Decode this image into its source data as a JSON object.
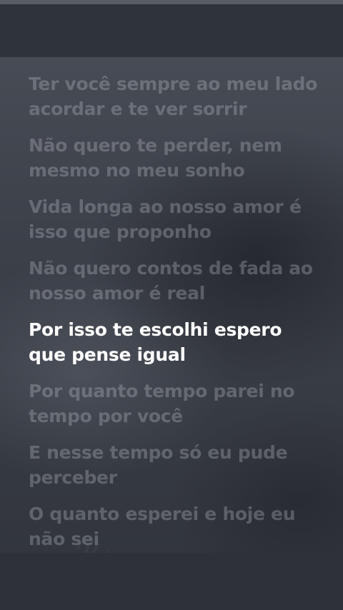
{
  "lyrics": [
    {
      "text": "Ter você sempre ao meu lado acordar e te ver sorrir",
      "active": false
    },
    {
      "text": "Não quero te perder, nem mesmo no meu sonho",
      "active": false
    },
    {
      "text": "Vida longa ao nosso amor é isso que proponho",
      "active": false
    },
    {
      "text": "Não quero contos de fada ao nosso amor é real",
      "active": false
    },
    {
      "text": "Por isso te escolhi espero que pense igual",
      "active": true
    },
    {
      "text": "Por quanto tempo parei no tempo por você",
      "active": false
    },
    {
      "text": "E nesse tempo só eu pude perceber",
      "active": false
    },
    {
      "text": "O quanto esperei e hoje eu não sei",
      "active": false
    }
  ],
  "colors": {
    "active_line": "#ffffff",
    "inactive_line": "#c8cbd2"
  }
}
